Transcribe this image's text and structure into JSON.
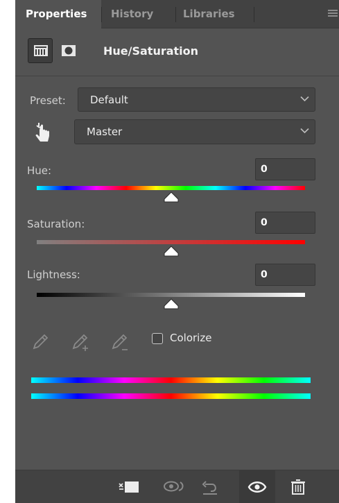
{
  "tabs": [
    {
      "label": "Properties",
      "active": true
    },
    {
      "label": "History",
      "active": false
    },
    {
      "label": "Libraries",
      "active": false
    }
  ],
  "header": {
    "title": "Hue/Saturation",
    "icons": [
      "adjustment-layer-icon",
      "layer-mask-icon"
    ]
  },
  "preset": {
    "label": "Preset:",
    "value": "Default"
  },
  "channel": {
    "value": "Master",
    "tool_icon": "targeted-adjustment-hand-icon"
  },
  "sliders": [
    {
      "key": "hue",
      "label": "Hue:",
      "value": "0",
      "position": 0.5
    },
    {
      "key": "saturation",
      "label": "Saturation:",
      "value": "0",
      "position": 0.5
    },
    {
      "key": "lightness",
      "label": "Lightness:",
      "value": "0",
      "position": 0.5
    }
  ],
  "eyedroppers": [
    "eyedropper-icon",
    "eyedropper-plus-icon",
    "eyedropper-minus-icon"
  ],
  "colorize": {
    "label": "Colorize",
    "checked": false
  },
  "footer_buttons": [
    {
      "name": "clip-to-layer-icon",
      "pressed": false
    },
    {
      "name": "view-previous-state-icon",
      "pressed": false
    },
    {
      "name": "reset-icon",
      "pressed": false
    },
    {
      "name": "visibility-eye-icon",
      "pressed": true
    },
    {
      "name": "trash-icon",
      "pressed": false
    }
  ],
  "colors": {
    "panel_bg": "#535353",
    "tabbar_bg": "#424242",
    "field_bg": "#454545"
  }
}
